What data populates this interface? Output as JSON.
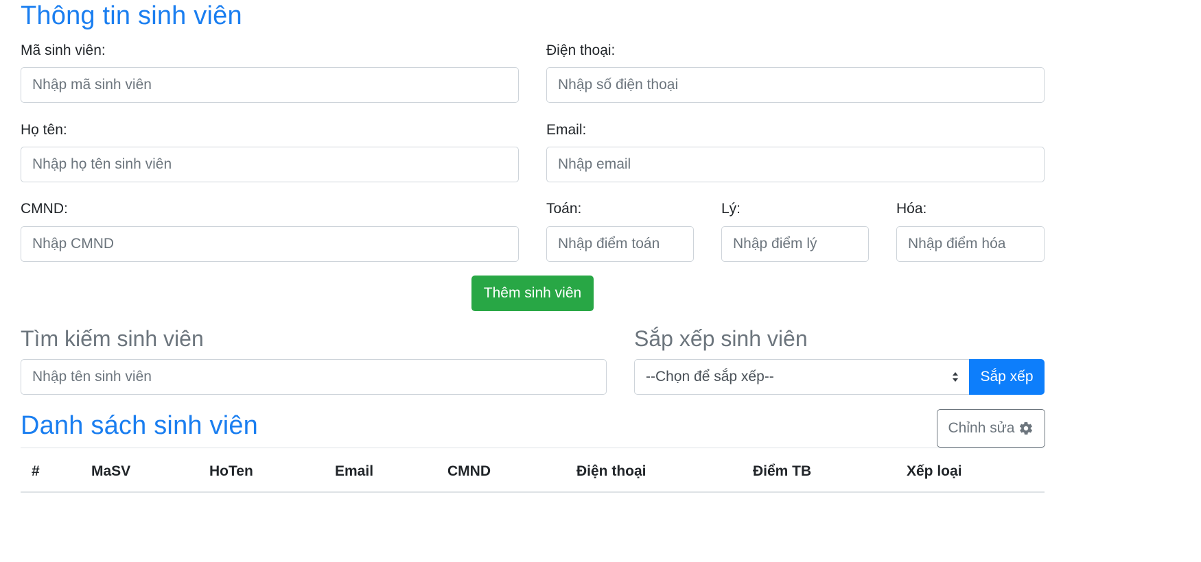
{
  "form": {
    "title": "Thông tin sinh viên",
    "ma_sv": {
      "label": "Mã sinh viên:",
      "placeholder": "Nhập mã sinh viên"
    },
    "dien_thoai": {
      "label": "Điện thoại:",
      "placeholder": "Nhập số điện thoại"
    },
    "ho_ten": {
      "label": "Họ tên:",
      "placeholder": "Nhập họ tên sinh viên"
    },
    "email": {
      "label": "Email:",
      "placeholder": "Nhập email"
    },
    "cmnd": {
      "label": "CMND:",
      "placeholder": "Nhập CMND"
    },
    "toan": {
      "label": "Toán:",
      "placeholder": "Nhập điểm toán"
    },
    "ly": {
      "label": "Lý:",
      "placeholder": "Nhập điểm lý"
    },
    "hoa": {
      "label": "Hóa:",
      "placeholder": "Nhập điểm hóa"
    },
    "add_button": "Thêm sinh viên"
  },
  "search": {
    "title": "Tìm kiếm sinh viên",
    "placeholder": "Nhập tên sinh viên"
  },
  "sort": {
    "title": "Sắp xếp sinh viên",
    "selected": "--Chọn để sắp xếp--",
    "button": "Sắp xếp"
  },
  "list": {
    "title": "Danh sách sinh viên",
    "edit_button": "Chỉnh sửa",
    "edit_icon": "gear-icon",
    "columns": [
      "#",
      "MaSV",
      "HoTen",
      "Email",
      "CMND",
      "Điện thoại",
      "Điểm TB",
      "Xếp loại"
    ]
  },
  "colors": {
    "primary": "#1a7ef0",
    "success": "#28a745",
    "secondary": "#6c757d"
  }
}
